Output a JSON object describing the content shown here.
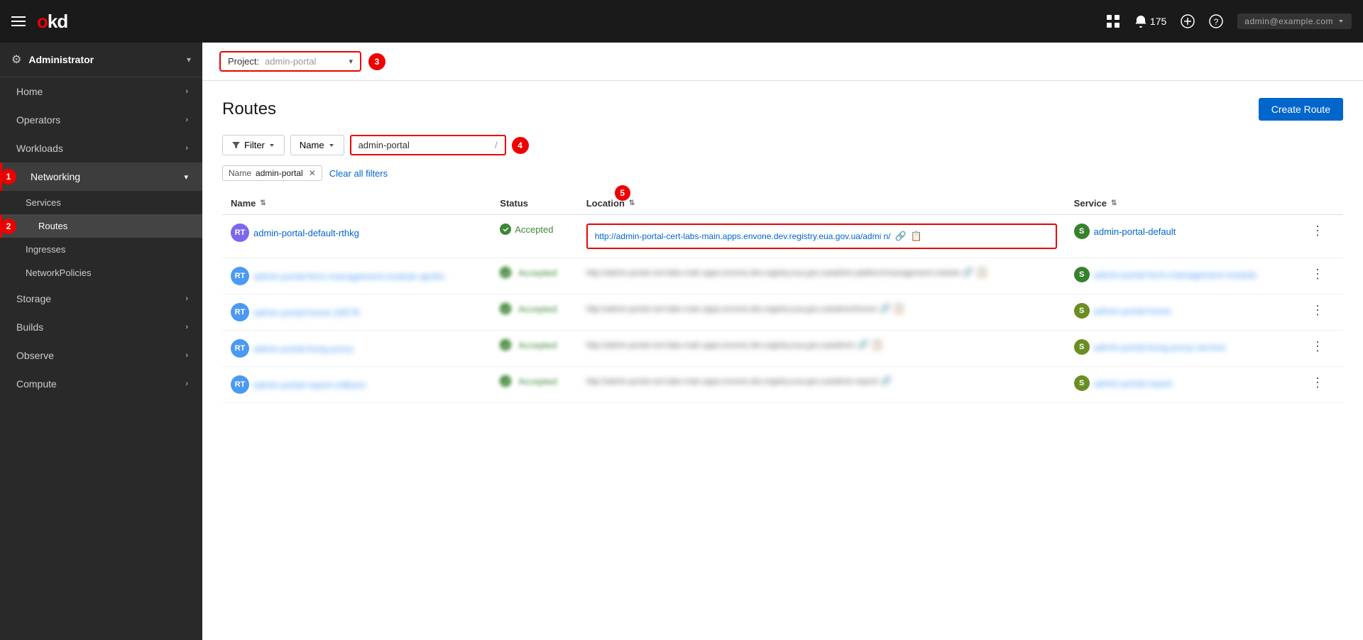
{
  "navbar": {
    "hamburger_label": "Menu",
    "logo_o": "o",
    "logo_k": "k",
    "logo_d": "d",
    "notifications_icon": "bell-icon",
    "notifications_count": "175",
    "add_icon": "plus-icon",
    "help_icon": "question-icon",
    "user_display": "admin@example.com",
    "apps_icon": "grid-icon"
  },
  "sidebar": {
    "role": "Administrator",
    "role_icon": "cog-icon",
    "items": [
      {
        "label": "Home",
        "has_children": true
      },
      {
        "label": "Operators",
        "has_children": true
      },
      {
        "label": "Workloads",
        "has_children": true
      },
      {
        "label": "Networking",
        "has_children": true,
        "active": true
      },
      {
        "label": "Storage",
        "has_children": true
      },
      {
        "label": "Builds",
        "has_children": true
      },
      {
        "label": "Observe",
        "has_children": true
      },
      {
        "label": "Compute",
        "has_children": true
      }
    ],
    "networking_sub": [
      {
        "label": "Services",
        "active": false
      },
      {
        "label": "Routes",
        "active": true
      },
      {
        "label": "Ingresses",
        "active": false
      },
      {
        "label": "NetworkPolicies",
        "active": false
      }
    ]
  },
  "project_bar": {
    "label": "Project:",
    "value": "admin-portal",
    "step": "3"
  },
  "page": {
    "title": "Routes",
    "create_button": "Create Route"
  },
  "filter": {
    "filter_label": "Filter",
    "name_label": "Name",
    "search_value": "admin-portal",
    "search_separator": "/",
    "step": "4"
  },
  "active_filters": {
    "tag_label": "Name",
    "tag_value": "admin-portal",
    "clear_label": "Clear all filters"
  },
  "table": {
    "columns": [
      {
        "label": "Name",
        "sortable": true
      },
      {
        "label": "Status",
        "sortable": false
      },
      {
        "label": "Location",
        "sortable": true
      },
      {
        "label": "Service",
        "sortable": true
      }
    ],
    "rows": [
      {
        "badge": "RT",
        "badge_color": "#7b68ee",
        "name": "admin-portal-default-rthkg",
        "status": "Accepted",
        "location_url": "http://admin-portal-cert-labs-main.apps.envone.dev.registry.eua.gov.ua/admi n/",
        "location_highlighted": true,
        "service_badge": "S",
        "service_badge_color": "#38812f",
        "service": "admin-portal-default"
      },
      {
        "badge": "RT",
        "badge_color": "#4a9af5",
        "name": "admin-portal-form-management-module-ajmfm",
        "status": "Accepted",
        "location_url": "blurred-url-2",
        "location_highlighted": false,
        "service_badge": "S",
        "service_badge_color": "#38812f",
        "service": "admin-portal-form-management-module"
      },
      {
        "badge": "RT",
        "badge_color": "#4a9af5",
        "name": "admin-portal-home-26578",
        "status": "Accepted",
        "location_url": "blurred-url-3",
        "location_highlighted": false,
        "service_badge": "S",
        "service_badge_color": "#6b8e23",
        "service": "admin-portal-home"
      },
      {
        "badge": "RT",
        "badge_color": "#4a9af5",
        "name": "admin-portal-kong-proxy",
        "status": "Accepted",
        "location_url": "blurred-url-4",
        "location_highlighted": false,
        "service_badge": "S",
        "service_badge_color": "#6b8e23",
        "service": "admin-portal-kong-proxy-service"
      },
      {
        "badge": "RT",
        "badge_color": "#4a9af5",
        "name": "admin-portal-report-millions",
        "status": "Accepted",
        "location_url": "blurred-url-5",
        "location_highlighted": false,
        "service_badge": "S",
        "service_badge_color": "#6b8e23",
        "service": "admin-portal-report"
      }
    ]
  },
  "annotations": {
    "step1": "1",
    "step2": "2",
    "step5": "5"
  }
}
